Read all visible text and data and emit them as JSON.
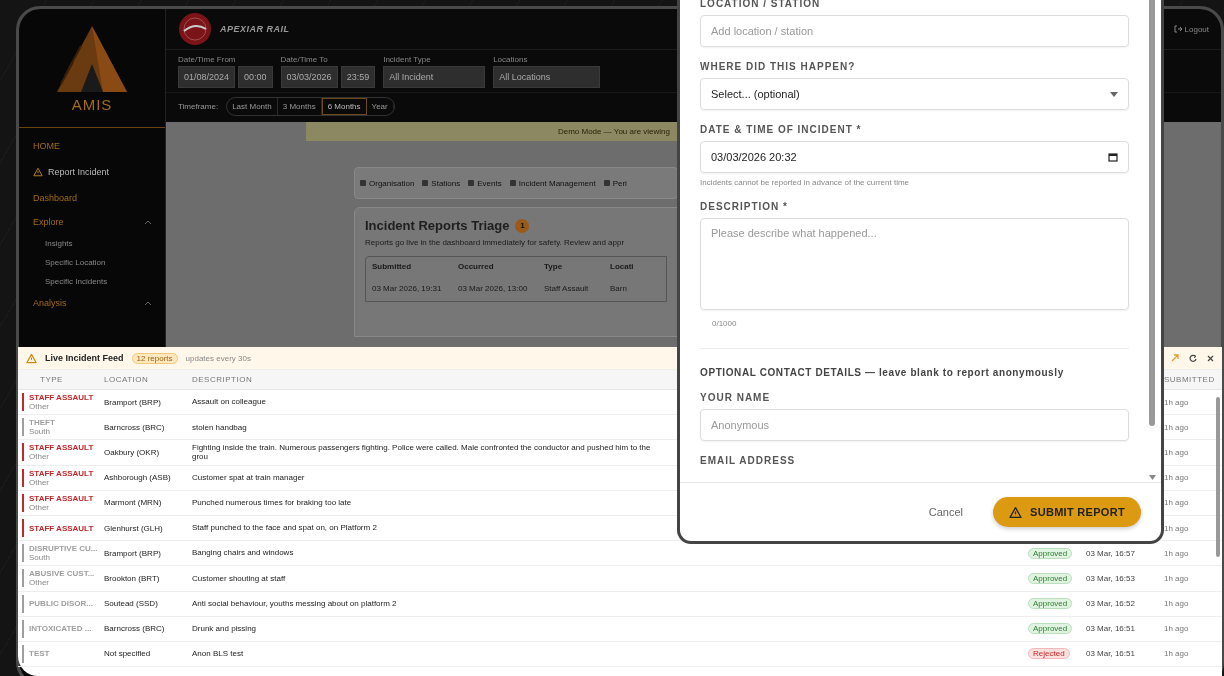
{
  "sidebar": {
    "logo_text": "AMIS",
    "items": [
      {
        "label": "HOME",
        "kind": "section"
      },
      {
        "label": "Report Incident",
        "kind": "action"
      },
      {
        "label": "Dashboard",
        "kind": "section"
      },
      {
        "label": "Explore",
        "kind": "group"
      },
      {
        "label": "Insights",
        "kind": "sub"
      },
      {
        "label": "Specific Location",
        "kind": "sub"
      },
      {
        "label": "Specific Incidents",
        "kind": "sub"
      },
      {
        "label": "Analysis",
        "kind": "group"
      }
    ]
  },
  "header": {
    "brand": "APEXIAR RAIL",
    "logout": "Logout",
    "filters": [
      {
        "label": "Date/Time From",
        "kind": "datetime",
        "date": "01/08/2024",
        "time": "00:00"
      },
      {
        "label": "Date/Time To",
        "kind": "datetime",
        "date": "03/03/2026",
        "time": "23:59"
      },
      {
        "label": "Incident Type",
        "kind": "select",
        "value": "All Incident"
      },
      {
        "label": "Locations",
        "kind": "select",
        "value": "All Locations"
      }
    ],
    "timeframe_label": "Timeframe:",
    "timeframes": [
      {
        "label": "Last Month",
        "selected": false
      },
      {
        "label": "3 Months",
        "selected": false
      },
      {
        "label": "6 Months",
        "selected": true
      },
      {
        "label": "Year",
        "selected": false
      }
    ]
  },
  "demo_banner": "Demo Mode — You are viewing",
  "tabs": [
    "Organisation",
    "Stations",
    "Events",
    "Incident Management",
    "Peri"
  ],
  "triage": {
    "title": "Incident Reports Triage",
    "badge": "1",
    "subtitle": "Reports go live in the dashboard immediately for safety. Review and appr",
    "columns": [
      "Submitted",
      "Occurred",
      "Type",
      "Locati"
    ],
    "rows": [
      [
        "03 Mar 2026, 19:31",
        "03 Mar 2026, 13:00",
        "Staff Assault",
        "Barn"
      ]
    ]
  },
  "feed": {
    "title": "Live Incident Feed",
    "count": "12 reports",
    "refresh_note": "updates every 30s",
    "columns": [
      "TYPE",
      "LOCATION",
      "DESCRIPTION",
      "SUBMITTED"
    ],
    "rows": [
      {
        "type": "STAFF ASSAULT",
        "region": "Other",
        "color": "#c0282d",
        "location": "Bramport (BRP)",
        "description": "Assault on colleague",
        "ago": "1h ago"
      },
      {
        "type": "THEFT",
        "region": "South",
        "color": "#9e9e9e",
        "location": "Barncross (BRC)",
        "description": "stolen handbag",
        "ago": "1h ago"
      },
      {
        "type": "STAFF ASSAULT",
        "region": "Other",
        "color": "#c0282d",
        "location": "Oakbury (OKR)",
        "description": "Fighting inside the train. Numerous passengers fighting. Police were called. Male confronted the conductor and pushed him to the grou",
        "ago": "1h ago"
      },
      {
        "type": "STAFF ASSAULT",
        "region": "Other",
        "color": "#c0282d",
        "location": "Ashborough (ASB)",
        "description": "Customer spat at train manager",
        "ago": "1h ago"
      },
      {
        "type": "STAFF ASSAULT",
        "region": "Other",
        "color": "#c0282d",
        "location": "Marmont (MRN)",
        "description": "Punched numerous times for braking too late",
        "ago": "1h ago"
      },
      {
        "type": "STAFF ASSAULT",
        "color": "#c0282d",
        "location": "Glenhurst (GLH)",
        "description": "Staff punched to the face and spat on, on Platform 2",
        "ago": "1h ago"
      },
      {
        "type": "DISRUPTIVE CU...",
        "region": "South",
        "color": "#9e9e9e",
        "location": "Bramport (BRP)",
        "description": "Banging chairs and windows",
        "status": {
          "label": "Approved",
          "kind": "approved"
        },
        "date": "03 Mar, 16:57",
        "ago": "1h ago"
      },
      {
        "type": "ABUSIVE CUST...",
        "region": "Other",
        "color": "#9e9e9e",
        "location": "Brookton (BRT)",
        "description": "Customer shouting at staff",
        "status": {
          "label": "Approved",
          "kind": "approved"
        },
        "date": "03 Mar, 16:53",
        "ago": "1h ago"
      },
      {
        "type": "PUBLIC DISOR...",
        "color": "#9e9e9e",
        "location": "Soutead (SSD)",
        "description": "Anti social behaviour, youths messing about on platform 2",
        "status": {
          "label": "Approved",
          "kind": "approved"
        },
        "date": "03 Mar, 16:52",
        "ago": "1h ago"
      },
      {
        "type": "INTOXICATED ...",
        "color": "#9e9e9e",
        "location": "Barncross (BRC)",
        "description": "Drunk and pissing",
        "status": {
          "label": "Approved",
          "kind": "approved"
        },
        "date": "03 Mar, 16:51",
        "ago": "1h ago"
      },
      {
        "type": "TEST",
        "color": "#9e9e9e",
        "location": "Not specified",
        "description": "Anon BLS test",
        "status": {
          "label": "Rejected",
          "kind": "rejected"
        },
        "date": "03 Mar, 16:51",
        "ago": "1h ago"
      }
    ]
  },
  "modal": {
    "fields": [
      {
        "label": "LOCATION / STATION",
        "kind": "text",
        "placeholder": "Add location / station"
      },
      {
        "label": "WHERE DID THIS HAPPEN?",
        "kind": "select",
        "value": "Select... (optional)"
      },
      {
        "label": "DATE & TIME OF INCIDENT *",
        "kind": "datetime",
        "value": "03/03/2026 20:32",
        "hint": "Incidents cannot be reported in advance of the current time"
      },
      {
        "label": "DESCRIPTION *",
        "kind": "textarea",
        "placeholder": "Please describe what happened...",
        "counter": "0/1000"
      }
    ],
    "contact_heading": "OPTIONAL CONTACT DETAILS — leave blank to report anonymously",
    "contact_fields": [
      {
        "label": "YOUR NAME",
        "kind": "text",
        "placeholder": "Anonymous"
      },
      {
        "label": "EMAIL ADDRESS",
        "kind": "cut"
      }
    ],
    "cancel": "Cancel",
    "submit": "SUBMIT REPORT"
  }
}
